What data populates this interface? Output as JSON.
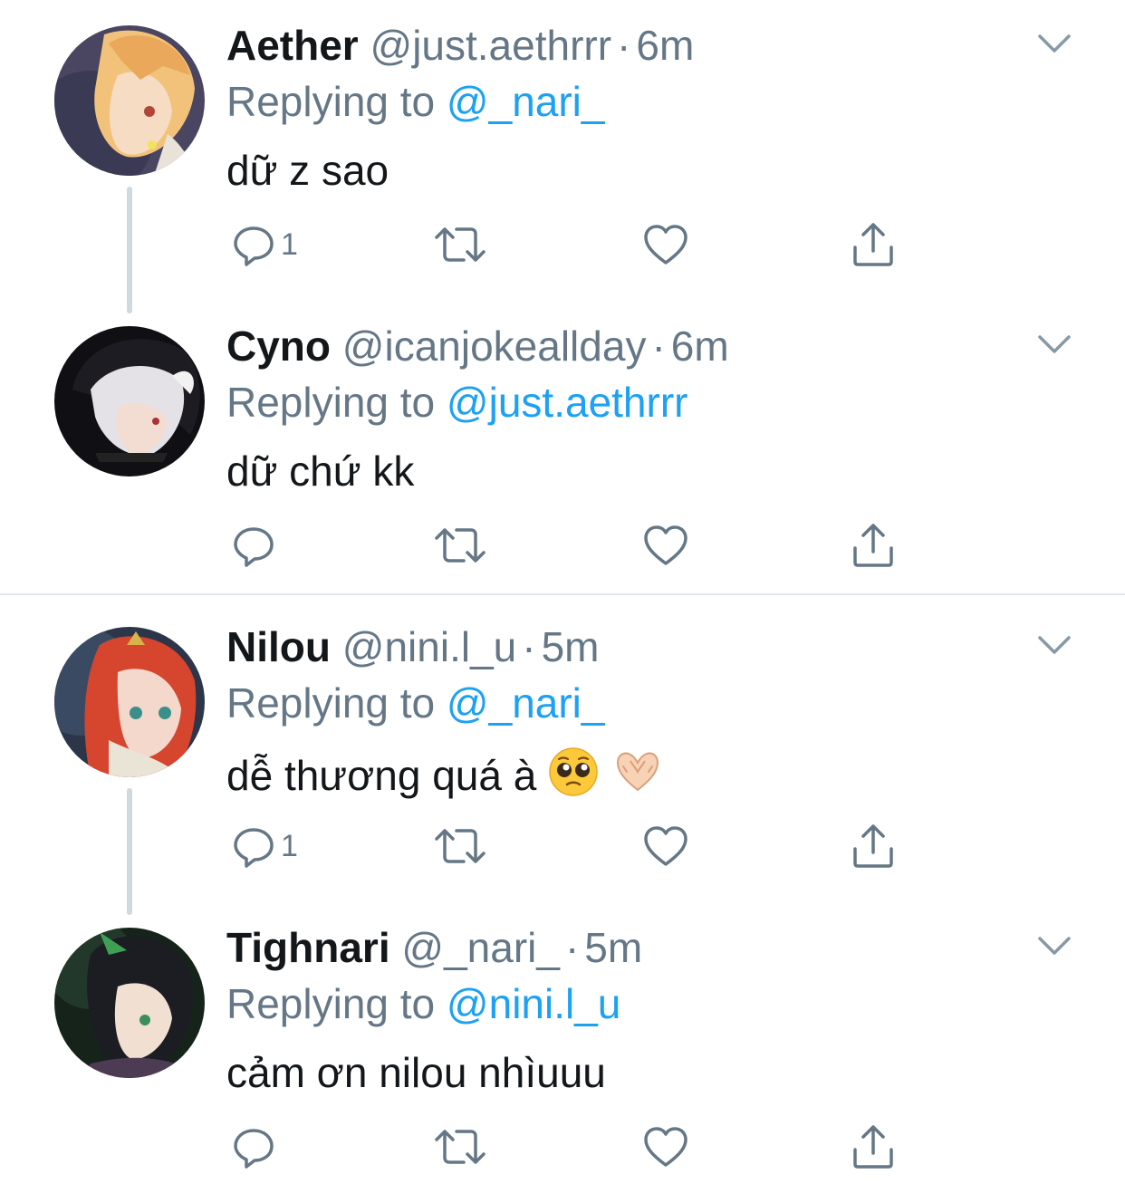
{
  "colors": {
    "accent": "#1da1f2",
    "secondary_text": "#657786",
    "primary_text": "#14171a",
    "thread_line": "#cfd9de",
    "divider": "#e1e8ed"
  },
  "icons": {
    "reply": "speech-bubble-icon",
    "retweet": "retweet-arrows-icon",
    "like": "heart-icon",
    "share": "share-upload-icon",
    "menu": "chevron-down-icon"
  },
  "tweets": [
    {
      "name": "Aether",
      "handle": "@just.aethrrr",
      "separator": "·",
      "time": "6m",
      "replying_label": "Replying to",
      "replying_to": "@_nari_",
      "text": "dữ z sao",
      "reply_count": "1"
    },
    {
      "name": "Cyno",
      "handle": "@icanjokeallday",
      "separator": "·",
      "time": "6m",
      "replying_label": "Replying to",
      "replying_to": "@just.aethrrr",
      "text": "dữ chứ kk",
      "reply_count": ""
    },
    {
      "name": "Nilou",
      "handle": "@nini.l_u",
      "separator": "·",
      "time": "5m",
      "replying_label": "Replying to",
      "replying_to": "@_nari_",
      "text": "dễ thương quá à",
      "emojis": [
        "pleading-face-emoji",
        "heart-hands-emoji"
      ],
      "reply_count": "1"
    },
    {
      "name": "Tighnari",
      "handle": "@_nari_",
      "separator": "·",
      "time": "5m",
      "replying_label": "Replying to",
      "replying_to": "@nini.l_u",
      "text": "cảm ơn nilou nhìuuu",
      "reply_count": ""
    }
  ]
}
